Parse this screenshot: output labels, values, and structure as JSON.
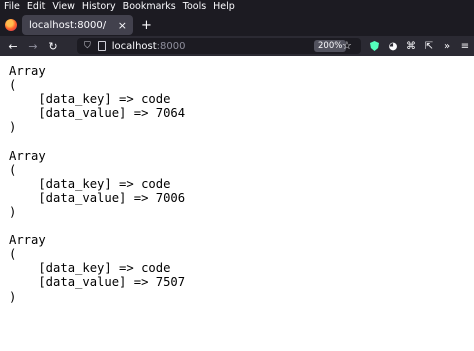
{
  "menu": [
    "File",
    "Edit",
    "View",
    "History",
    "Bookmarks",
    "Tools",
    "Help"
  ],
  "tab": {
    "title": "localhost:8000/",
    "close_icon": "×"
  },
  "newtab_icon": "+",
  "url": {
    "host": "localhost",
    "port": ":8000"
  },
  "zoom": "200%",
  "arrays": [
    {
      "key": "code",
      "value": "7064"
    },
    {
      "key": "code",
      "value": "7006"
    },
    {
      "key": "code",
      "value": "7507"
    }
  ],
  "colors": {
    "chrome_dark": "#1c1b22",
    "toolbar": "#2b2a33",
    "tab_active": "#42414d"
  }
}
